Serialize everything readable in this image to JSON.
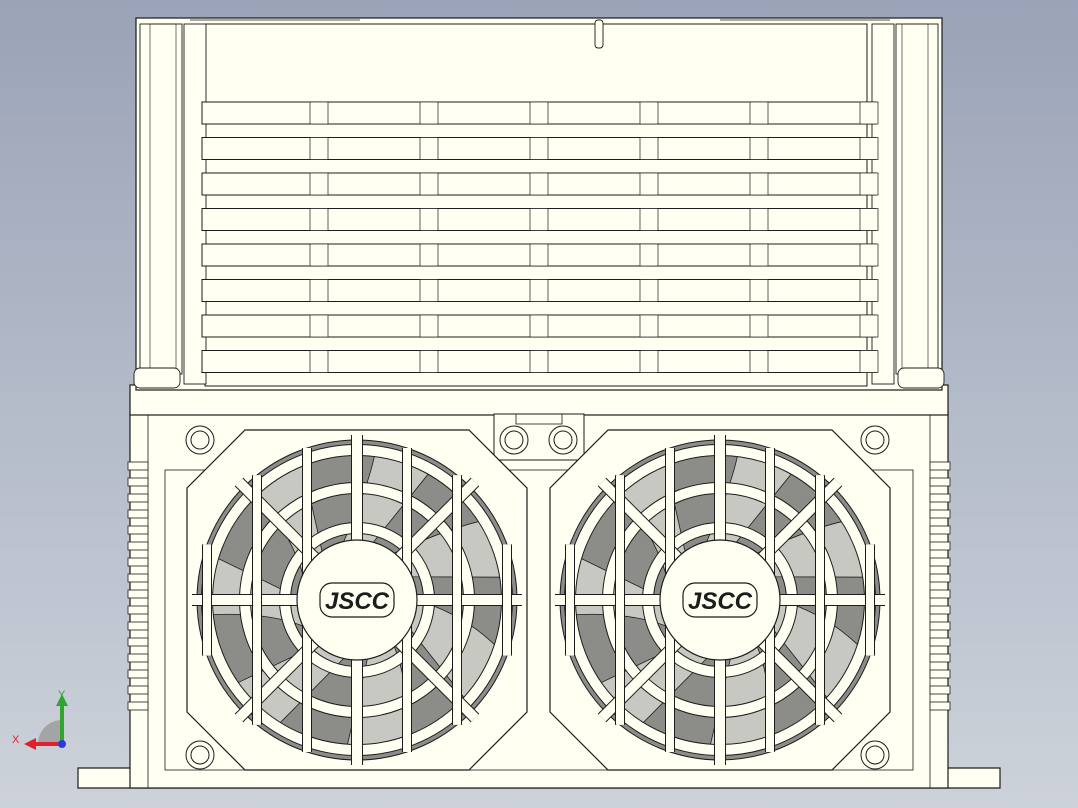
{
  "viewport": {
    "background_top": "#9aa3b7",
    "background_bottom": "#cdd2da"
  },
  "model": {
    "body_color": "#fffff2",
    "edge_color": "#1c1c1c",
    "shade_color": "#8c8c88",
    "fans": [
      {
        "logo": "JSCC"
      },
      {
        "logo": "JSCC"
      }
    ]
  },
  "triad": {
    "x_label": "X",
    "y_label": "Y",
    "x_color": "#e0202a",
    "y_color": "#2fa52f",
    "z_color": "#2a3cd8"
  }
}
